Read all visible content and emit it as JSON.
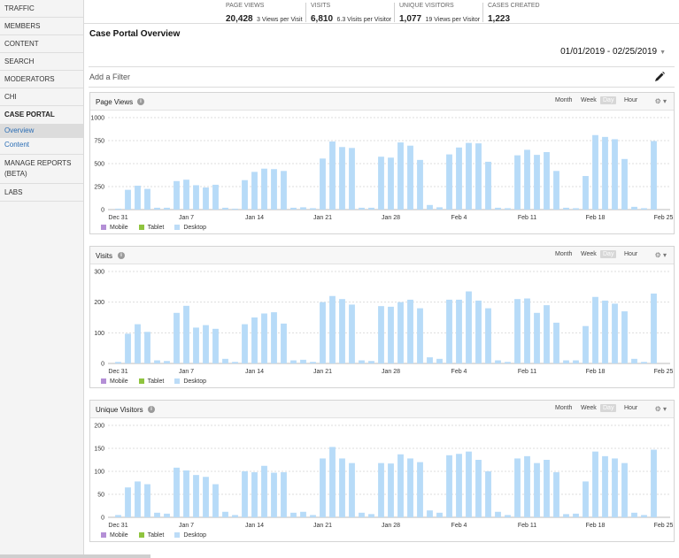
{
  "sidebar": {
    "items": [
      {
        "label": "TRAFFIC"
      },
      {
        "label": "MEMBERS"
      },
      {
        "label": "CONTENT"
      },
      {
        "label": "SEARCH"
      },
      {
        "label": "MODERATORS"
      },
      {
        "label": "CHI"
      },
      {
        "label": "CASE PORTAL"
      }
    ],
    "sub_items": [
      {
        "label": "Overview"
      },
      {
        "label": "Content"
      }
    ],
    "items_after": [
      {
        "label": "MANAGE REPORTS (BETA)"
      },
      {
        "label": "LABS"
      }
    ]
  },
  "stats": [
    {
      "label": "PAGE VIEWS",
      "value": "20,428",
      "sub": "3 Views per Visit"
    },
    {
      "label": "VISITS",
      "value": "6,810",
      "sub": "6.3 Visits per Visitor"
    },
    {
      "label": "UNIQUE VISITORS",
      "value": "1,077",
      "sub": "19 Views per Visitor"
    },
    {
      "label": "CASES CREATED",
      "value": "1,223",
      "sub": ""
    }
  ],
  "page_title": "Case Portal Overview",
  "date_range": "01/01/2019 - 02/25/2019",
  "filter_placeholder": "Add a Filter",
  "granularity": [
    "Month",
    "Week",
    "Day",
    "Hour"
  ],
  "active_granularity": "Day",
  "legend": [
    {
      "name": "Mobile",
      "color": "#b48fd6"
    },
    {
      "name": "Tablet",
      "color": "#8fc43f"
    },
    {
      "name": "Desktop",
      "color": "#bcdcf7"
    }
  ],
  "colors": {
    "bar": "#b7dbf8",
    "accent_link": "#2a6db5",
    "highlight_bar": "#5a88c6"
  },
  "chart_data": [
    {
      "type": "bar",
      "title": "Page Views",
      "x_tick_labels": [
        "Dec 31",
        "Jan 7",
        "Jan 14",
        "Jan 21",
        "Jan 28",
        "Feb 4",
        "Feb 11",
        "Feb 18",
        "Feb 25"
      ],
      "x": [
        "Dec 31",
        "Jan 1",
        "Jan 2",
        "Jan 3",
        "Jan 4",
        "Jan 5",
        "Jan 6",
        "Jan 7",
        "Jan 8",
        "Jan 9",
        "Jan 10",
        "Jan 11",
        "Jan 12",
        "Jan 13",
        "Jan 14",
        "Jan 15",
        "Jan 16",
        "Jan 17",
        "Jan 18",
        "Jan 19",
        "Jan 20",
        "Jan 21",
        "Jan 22",
        "Jan 23",
        "Jan 24",
        "Jan 25",
        "Jan 26",
        "Jan 27",
        "Jan 28",
        "Jan 29",
        "Jan 30",
        "Jan 31",
        "Feb 1",
        "Feb 2",
        "Feb 3",
        "Feb 4",
        "Feb 5",
        "Feb 6",
        "Feb 7",
        "Feb 8",
        "Feb 9",
        "Feb 10",
        "Feb 11",
        "Feb 12",
        "Feb 13",
        "Feb 14",
        "Feb 15",
        "Feb 16",
        "Feb 17",
        "Feb 18",
        "Feb 19",
        "Feb 20",
        "Feb 21",
        "Feb 22",
        "Feb 23",
        "Feb 24",
        "Feb 25"
      ],
      "series": [
        {
          "name": "Desktop",
          "values": [
            10,
            215,
            260,
            225,
            20,
            20,
            310,
            325,
            265,
            240,
            270,
            20,
            10,
            320,
            410,
            445,
            440,
            420,
            20,
            25,
            15,
            555,
            740,
            680,
            670,
            20,
            20,
            575,
            565,
            730,
            695,
            540,
            50,
            25,
            600,
            675,
            725,
            720,
            520,
            20,
            15,
            590,
            650,
            595,
            625,
            420,
            20,
            15,
            365,
            810,
            790,
            765,
            550,
            30,
            15,
            745
          ]
        }
      ],
      "yticks": [
        0,
        250,
        500,
        750,
        1000
      ],
      "ylim": [
        0,
        1000
      ]
    },
    {
      "type": "bar",
      "title": "Visits",
      "x_tick_labels": [
        "Dec 31",
        "Jan 7",
        "Jan 14",
        "Jan 21",
        "Jan 28",
        "Feb 4",
        "Feb 11",
        "Feb 18",
        "Feb 25"
      ],
      "x": [
        "Dec 31",
        "Jan 1",
        "Jan 2",
        "Jan 3",
        "Jan 4",
        "Jan 5",
        "Jan 6",
        "Jan 7",
        "Jan 8",
        "Jan 9",
        "Jan 10",
        "Jan 11",
        "Jan 12",
        "Jan 13",
        "Jan 14",
        "Jan 15",
        "Jan 16",
        "Jan 17",
        "Jan 18",
        "Jan 19",
        "Jan 20",
        "Jan 21",
        "Jan 22",
        "Jan 23",
        "Jan 24",
        "Jan 25",
        "Jan 26",
        "Jan 27",
        "Jan 28",
        "Jan 29",
        "Jan 30",
        "Jan 31",
        "Feb 1",
        "Feb 2",
        "Feb 3",
        "Feb 4",
        "Feb 5",
        "Feb 6",
        "Feb 7",
        "Feb 8",
        "Feb 9",
        "Feb 10",
        "Feb 11",
        "Feb 12",
        "Feb 13",
        "Feb 14",
        "Feb 15",
        "Feb 16",
        "Feb 17",
        "Feb 18",
        "Feb 19",
        "Feb 20",
        "Feb 21",
        "Feb 22",
        "Feb 23",
        "Feb 24",
        "Feb 25"
      ],
      "series": [
        {
          "name": "Desktop",
          "values": [
            5,
            97,
            128,
            103,
            10,
            8,
            165,
            188,
            117,
            125,
            113,
            15,
            5,
            128,
            150,
            163,
            167,
            130,
            10,
            12,
            5,
            200,
            220,
            210,
            192,
            10,
            8,
            187,
            185,
            200,
            208,
            180,
            20,
            15,
            208,
            208,
            235,
            205,
            180,
            10,
            5,
            210,
            212,
            165,
            190,
            133,
            10,
            10,
            122,
            217,
            205,
            195,
            170,
            15,
            5,
            228
          ]
        }
      ],
      "yticks": [
        0,
        100,
        200,
        300
      ],
      "ylim": [
        0,
        300
      ]
    },
    {
      "type": "bar",
      "title": "Unique Visitors",
      "x_tick_labels": [
        "Dec 31",
        "Jan 7",
        "Jan 14",
        "Jan 21",
        "Jan 28",
        "Feb 4",
        "Feb 11",
        "Feb 18",
        "Feb 25"
      ],
      "x": [
        "Dec 31",
        "Jan 1",
        "Jan 2",
        "Jan 3",
        "Jan 4",
        "Jan 5",
        "Jan 6",
        "Jan 7",
        "Jan 8",
        "Jan 9",
        "Jan 10",
        "Jan 11",
        "Jan 12",
        "Jan 13",
        "Jan 14",
        "Jan 15",
        "Jan 16",
        "Jan 17",
        "Jan 18",
        "Jan 19",
        "Jan 20",
        "Jan 21",
        "Jan 22",
        "Jan 23",
        "Jan 24",
        "Jan 25",
        "Jan 26",
        "Jan 27",
        "Jan 28",
        "Jan 29",
        "Jan 30",
        "Jan 31",
        "Feb 1",
        "Feb 2",
        "Feb 3",
        "Feb 4",
        "Feb 5",
        "Feb 6",
        "Feb 7",
        "Feb 8",
        "Feb 9",
        "Feb 10",
        "Feb 11",
        "Feb 12",
        "Feb 13",
        "Feb 14",
        "Feb 15",
        "Feb 16",
        "Feb 17",
        "Feb 18",
        "Feb 19",
        "Feb 20",
        "Feb 21",
        "Feb 22",
        "Feb 23",
        "Feb 24",
        "Feb 25"
      ],
      "series": [
        {
          "name": "Desktop",
          "values": [
            5,
            65,
            78,
            72,
            10,
            8,
            108,
            102,
            92,
            88,
            72,
            12,
            5,
            100,
            98,
            112,
            97,
            98,
            10,
            12,
            5,
            128,
            153,
            128,
            118,
            10,
            7,
            118,
            117,
            137,
            128,
            120,
            15,
            10,
            135,
            138,
            143,
            125,
            100,
            12,
            5,
            128,
            133,
            118,
            125,
            98,
            7,
            8,
            78,
            143,
            133,
            128,
            118,
            10,
            5,
            147
          ]
        }
      ],
      "yticks": [
        0,
        50,
        100,
        150,
        200
      ],
      "ylim": [
        0,
        200
      ]
    }
  ]
}
